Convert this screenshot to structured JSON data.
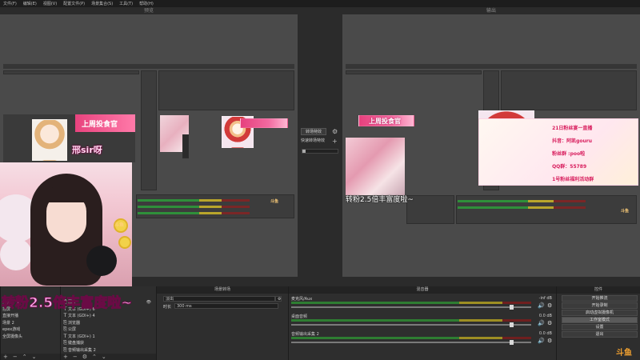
{
  "menubar": {
    "items": [
      "文件(F)",
      "编辑(E)",
      "视图(V)",
      "配置文件(P)",
      "场景集合(S)",
      "工具(T)",
      "帮助(H)"
    ]
  },
  "preview": {
    "title": "预览"
  },
  "program": {
    "title": "输出"
  },
  "transition": {
    "button_label": "转场特效",
    "secondary_label": "快速转场特效",
    "gear_icon": "gear-icon",
    "add_icon": "plus-icon"
  },
  "stream": {
    "overlay_text": "转粉2.5倍丰富度啦~",
    "program_overlay_text": "转粉2.5倍丰富度啦~",
    "minibanner_title": "上周投食官",
    "minibanner_name": "邢sir呀",
    "program_banner_title": "上周投食官",
    "info_card_lines": [
      "21日粉丝宴一直播",
      "抖音：阿凯gouru",
      "粉丝群 :poo啦",
      "QQ群：55789",
      "1号粉丝福利活动群"
    ],
    "watermark": "斗鱼"
  },
  "scenes_panel": {
    "items": [
      {
        "icon": "⎘",
        "label": "抖音"
      },
      {
        "icon": "⎘",
        "label": "挂屏"
      },
      {
        "icon": "⎘",
        "label": "直接开播"
      },
      {
        "icon": "⎘",
        "label": "场景 2"
      },
      {
        "icon": "⎘",
        "label": "epex游戏"
      },
      {
        "icon": "⎘",
        "label": "全屏摄像头"
      }
    ],
    "footer_icons": [
      "+",
      "−",
      "⌃",
      "⌄"
    ]
  },
  "sources_panel": {
    "items": [
      {
        "icon": "⎘",
        "label": "图片"
      },
      {
        "icon": "T",
        "label": "文本 (GDI+) 6"
      },
      {
        "icon": "T",
        "label": "文本 (GDI+) 4"
      },
      {
        "icon": "⎘",
        "label": "浏览器"
      },
      {
        "icon": "⎘",
        "label": "公屏"
      },
      {
        "icon": "T",
        "label": "文本 (GDI+) 1"
      },
      {
        "icon": "⎘",
        "label": "键盘捕获"
      },
      {
        "icon": "⎘",
        "label": "音频输出采集 2"
      }
    ],
    "footer_icons": [
      "+",
      "−",
      "⚙",
      "⌃",
      "⌄"
    ]
  },
  "filters_panel": {
    "title": "场景转场",
    "field1_label": "淡出",
    "field2_label": "时长",
    "field2_value": "300 ms"
  },
  "mixer_panel": {
    "title": "混音器",
    "channels": [
      {
        "name": "麦克风/Aux",
        "db": "-inf dB"
      },
      {
        "name": "桌面音频",
        "db": "0.0 dB"
      },
      {
        "name": "音频输出采集 2",
        "db": "0.0 dB"
      }
    ]
  },
  "controls_panel": {
    "title": "控件",
    "buttons": [
      "开始推流",
      "开始录制",
      "启动虚拟摄像机",
      "工作室模式",
      "设置",
      "退出"
    ],
    "active_index": 3
  }
}
